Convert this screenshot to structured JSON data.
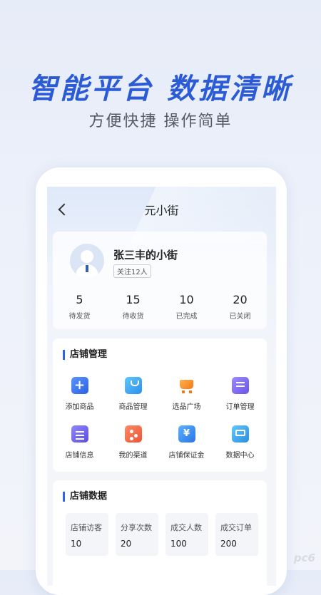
{
  "banner": {
    "title": "智能平台 数据清晰",
    "subtitle": "方便快捷 操作简单"
  },
  "nav": {
    "title": "元小街"
  },
  "profile": {
    "shop_name": "张三丰的小街",
    "follow_tag": "关注12人",
    "stats": [
      {
        "num": "5",
        "label": "待发货"
      },
      {
        "num": "15",
        "label": "待收货"
      },
      {
        "num": "10",
        "label": "已完成"
      },
      {
        "num": "20",
        "label": "已关闭"
      }
    ]
  },
  "manage": {
    "title": "店铺管理",
    "items": [
      {
        "label": "添加商品",
        "icon": "add-product-icon"
      },
      {
        "label": "商品管理",
        "icon": "shopping-bag-icon"
      },
      {
        "label": "选品广场",
        "icon": "cart-icon"
      },
      {
        "label": "订单管理",
        "icon": "order-list-icon"
      },
      {
        "label": "店铺信息",
        "icon": "clipboard-icon"
      },
      {
        "label": "我的渠道",
        "icon": "share-network-icon"
      },
      {
        "label": "店铺保证金",
        "icon": "yen-shield-icon"
      },
      {
        "label": "数据中心",
        "icon": "monitor-chart-icon"
      }
    ]
  },
  "shop_data": {
    "title": "店铺数据",
    "boxes": [
      {
        "label": "店铺访客",
        "value": "10"
      },
      {
        "label": "分享次数",
        "value": "20"
      },
      {
        "label": "成交人数",
        "value": "100"
      },
      {
        "label": "成交订单",
        "value": "200"
      }
    ]
  },
  "watermark": "pc6"
}
